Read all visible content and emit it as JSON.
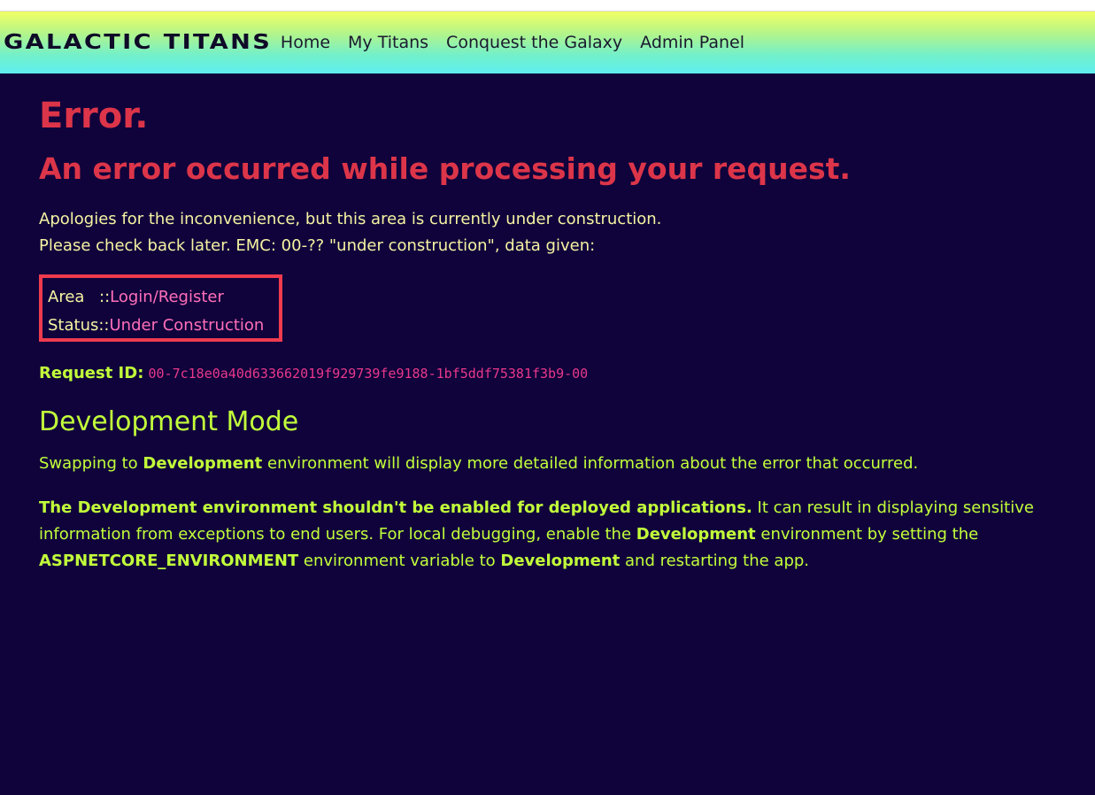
{
  "header": {
    "brand": "GALACTIC TITANS",
    "nav": [
      "Home",
      "My Titans",
      "Conquest the Galaxy",
      "Admin Panel"
    ]
  },
  "error": {
    "title": "Error.",
    "subtitle": "An error occurred while processing your request.",
    "message_line1": "Apologies for the inconvenience, but this area is currently under construction.",
    "message_line2": "Please check back later. EMC: 00-?? \"under construction\", data given:"
  },
  "info": {
    "rows": [
      {
        "key": "Area",
        "sep": "::",
        "value": "Login/Register"
      },
      {
        "key": "Status",
        "sep": "::",
        "value": "Under Construction"
      }
    ]
  },
  "request": {
    "label": "Request ID:",
    "id": "00-7c18e0a40d633662019f929739fe9188-1bf5ddf75381f3b9-00"
  },
  "dev": {
    "title": "Development Mode",
    "p1_pre": "Swapping to ",
    "p1_bold": "Development",
    "p1_post": " environment will display more detailed information about the error that occurred.",
    "p2_bold1": "The Development environment shouldn't be enabled for deployed applications.",
    "p2_text1": " It can result in displaying sensitive information from exceptions to end users. For local debugging, enable the ",
    "p2_bold2": "Development",
    "p2_text2": " environment by setting the ",
    "p2_bold3": "ASPNETCORE_ENVIRONMENT",
    "p2_text3": " environment variable to ",
    "p2_bold4": "Development",
    "p2_text4": " and restarting the app."
  },
  "colors": {
    "background": "#10033c",
    "error": "#dc3549",
    "accent_green": "#c2ff3a",
    "pale_yellow": "#f6f3a2",
    "pink": "#ff6fb8",
    "box_border": "#ee3b4e"
  }
}
